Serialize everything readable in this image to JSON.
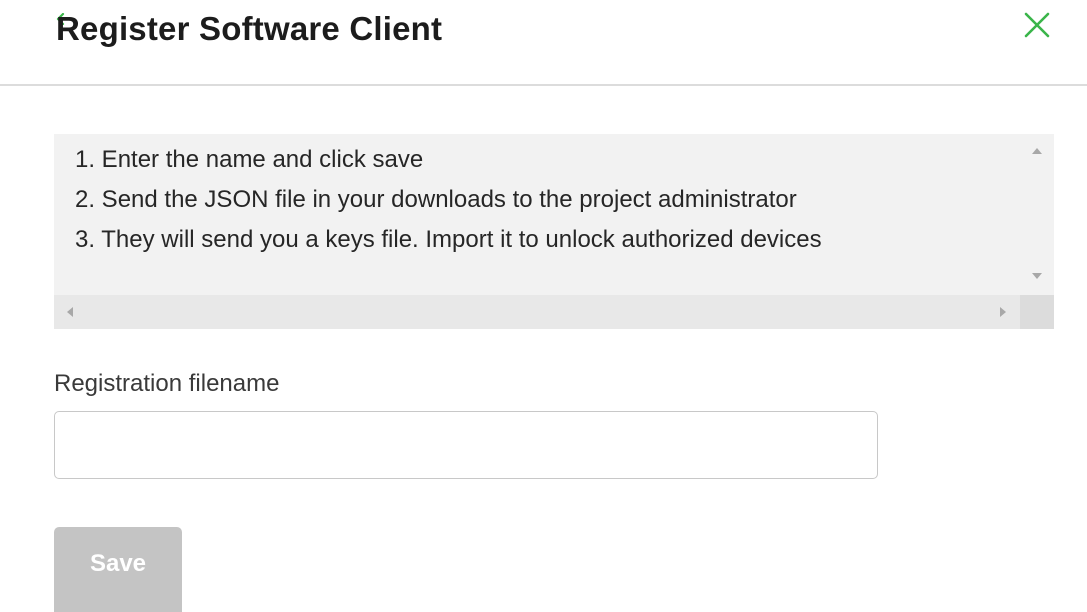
{
  "dialog": {
    "title": "Register Software Client",
    "close_icon": "close-x-icon",
    "back_icon": "back-arrow-icon"
  },
  "instructions": {
    "steps": [
      "1. Enter the name and click save",
      "2. Send the JSON file in your downloads to the project administrator",
      "3. They will send you a keys file. Import it to unlock authorized devices"
    ]
  },
  "form": {
    "filename_label": "Registration filename",
    "filename_value": "",
    "filename_placeholder": ""
  },
  "actions": {
    "save_label": "Save",
    "save_enabled": false
  },
  "colors": {
    "accent": "#3ab54a",
    "save_disabled_bg": "#c4c4c4",
    "instructions_bg": "#f2f2f2"
  }
}
